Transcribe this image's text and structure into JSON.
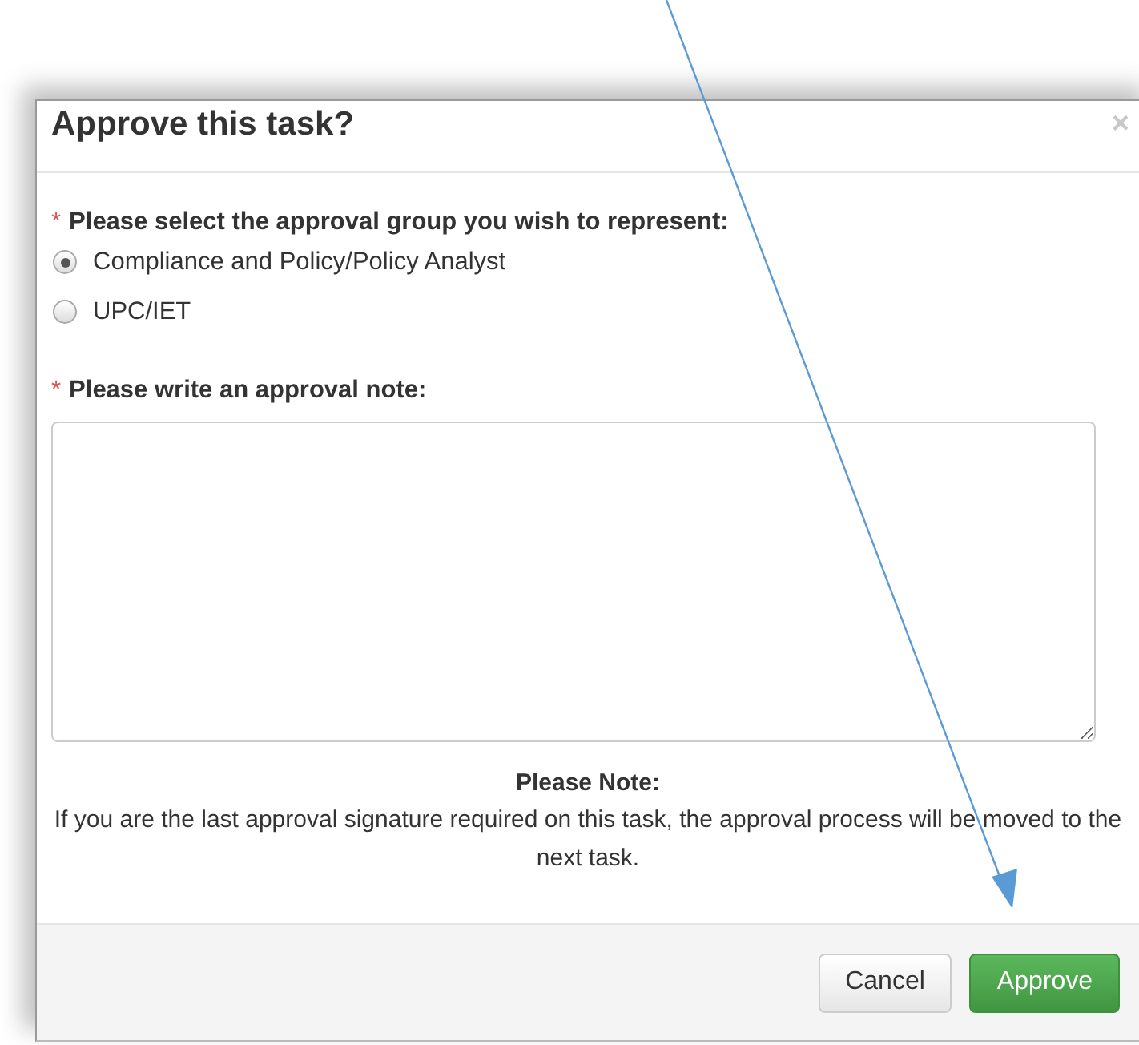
{
  "dialog": {
    "title": "Approve this task?",
    "close": "×",
    "group_question": {
      "required_mark": "*",
      "label": "Please select the approval group you wish to represent:"
    },
    "groups": [
      {
        "label": "Compliance and Policy/Policy Analyst",
        "selected": true
      },
      {
        "label": "UPC/IET",
        "selected": false
      }
    ],
    "note_question": {
      "required_mark": "*",
      "label": "Please write an approval note:"
    },
    "note_heading": "Please Note:",
    "note_text": "If you are the last approval signature required on this task, the approval process will be moved to the next task.",
    "buttons": [
      {
        "label": "Cancel",
        "kind": "default"
      },
      {
        "label": "Approve",
        "kind": "primary"
      }
    ]
  }
}
